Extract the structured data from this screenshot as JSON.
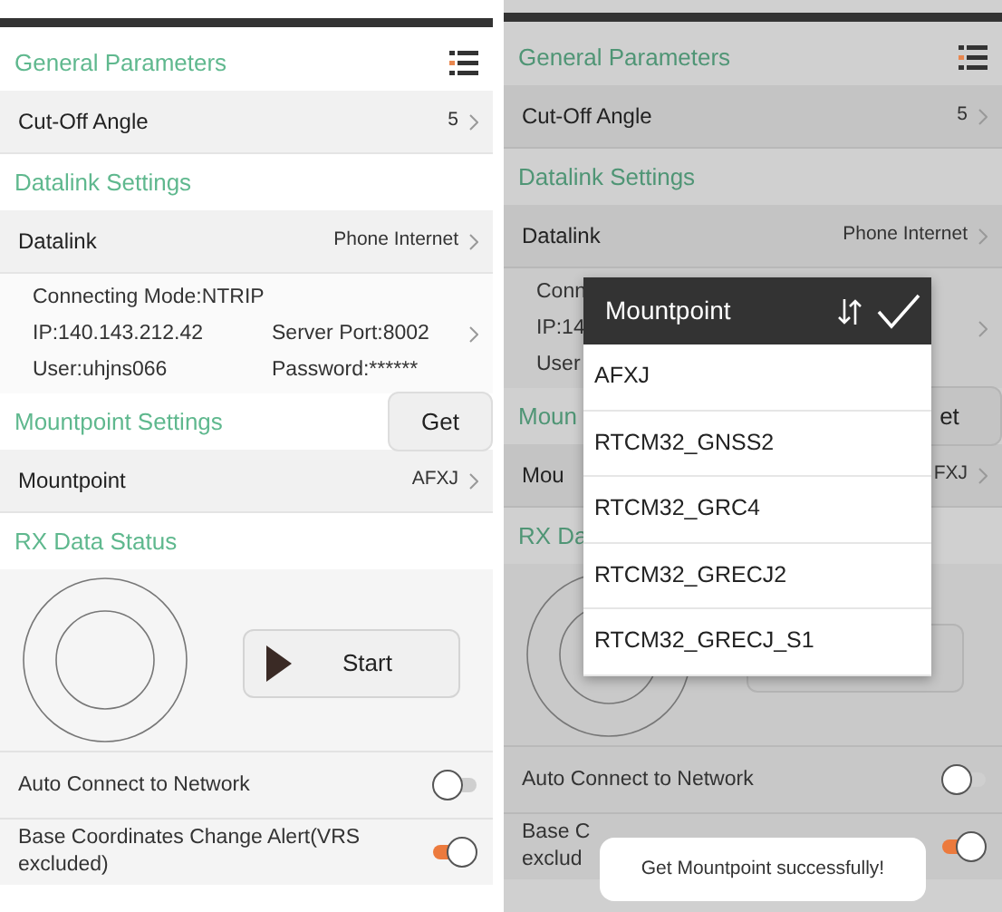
{
  "screens": [
    {
      "dimmed": false,
      "rows": [
        {
          "kind": "section",
          "title": "General Parameters",
          "menu": true
        },
        {
          "kind": "value",
          "label": "Cut-Off Angle",
          "value": "5"
        },
        {
          "kind": "section",
          "title": "Datalink Settings"
        },
        {
          "kind": "value",
          "label": "Datalink",
          "value": "Phone Internet"
        },
        {
          "kind": "connection",
          "lines": [
            [
              "Connecting Mode:NTRIP"
            ],
            [
              "IP:140.143.212.42",
              "Server Port:8002"
            ],
            [
              "User:uhjns066",
              "Password:******"
            ]
          ]
        },
        {
          "kind": "section",
          "title": "Mountpoint Settings",
          "button": "Get"
        },
        {
          "kind": "value",
          "label": "Mountpoint",
          "value": "AFXJ"
        },
        {
          "kind": "section",
          "title": "RX Data Status"
        },
        {
          "kind": "rx",
          "button": "Start"
        },
        {
          "kind": "toggle",
          "label_lines": [
            "Auto Connect to Network"
          ],
          "on": false
        },
        {
          "kind": "toggle",
          "label_lines": [
            "Base Coordinates Change Alert(VRS",
            "excluded)"
          ],
          "on": true
        }
      ]
    },
    {
      "dimmed": true,
      "rows": [
        {
          "kind": "section",
          "title": "General Parameters",
          "menu": true
        },
        {
          "kind": "value",
          "label": "Cut-Off Angle",
          "value": "5"
        },
        {
          "kind": "section",
          "title": "Datalink Settings"
        },
        {
          "kind": "value",
          "label": "Datalink",
          "value": "Phone Internet"
        },
        {
          "kind": "connection",
          "lines": [
            [
              "Conn"
            ],
            [
              "IP:14"
            ],
            [
              "User"
            ]
          ]
        },
        {
          "kind": "section",
          "title": "Moun",
          "button": "et"
        },
        {
          "kind": "value",
          "label": "Mou",
          "value": "FXJ"
        },
        {
          "kind": "section",
          "title": "RX Da"
        },
        {
          "kind": "rx"
        },
        {
          "kind": "toggle",
          "label_lines": [
            "Auto Connect to Network"
          ],
          "on": false
        },
        {
          "kind": "toggle",
          "label_lines": [
            "Base C",
            "exclud"
          ],
          "on": true
        }
      ],
      "dialog": {
        "title": "Mountpoint",
        "items": [
          "AFXJ",
          "RTCM32_GNSS2",
          "RTCM32_GRC4",
          "RTCM32_GRECJ2",
          "RTCM32_GRECJ_S1"
        ]
      },
      "toast": "Get Mountpoint successfully!"
    }
  ]
}
